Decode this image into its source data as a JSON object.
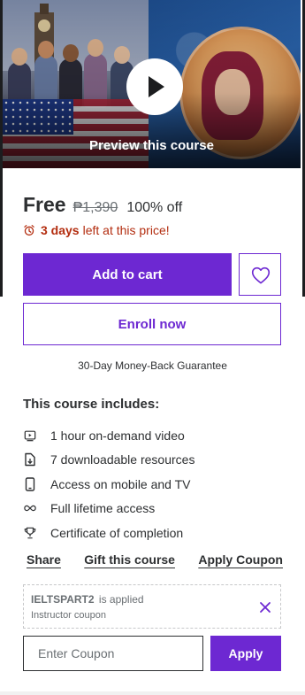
{
  "preview": {
    "label": "Preview this course"
  },
  "pricing": {
    "current": "Free",
    "original": "₱1,390",
    "discount": "100% off",
    "urgency_strong": "3 days",
    "urgency_rest": "left at this price!"
  },
  "actions": {
    "add_to_cart": "Add to cart",
    "enroll": "Enroll now",
    "guarantee": "30-Day Money-Back Guarantee"
  },
  "includes": {
    "title": "This course includes:",
    "items": [
      {
        "icon": "video-icon",
        "label": "1 hour on-demand video"
      },
      {
        "icon": "file-download-icon",
        "label": "7 downloadable resources"
      },
      {
        "icon": "mobile-icon",
        "label": "Access on mobile and TV"
      },
      {
        "icon": "infinity-icon",
        "label": "Full lifetime access"
      },
      {
        "icon": "trophy-icon",
        "label": "Certificate of completion"
      }
    ]
  },
  "links": {
    "share": "Share",
    "gift": "Gift this course",
    "apply_coupon": "Apply Coupon"
  },
  "coupon": {
    "code": "IELTSPART2",
    "applied_text": "is applied",
    "type": "Instructor coupon",
    "placeholder": "Enter Coupon",
    "apply_label": "Apply"
  },
  "colors": {
    "primary": "#6d28d2",
    "urgency": "#b32d0f",
    "text": "#2d2f31"
  }
}
